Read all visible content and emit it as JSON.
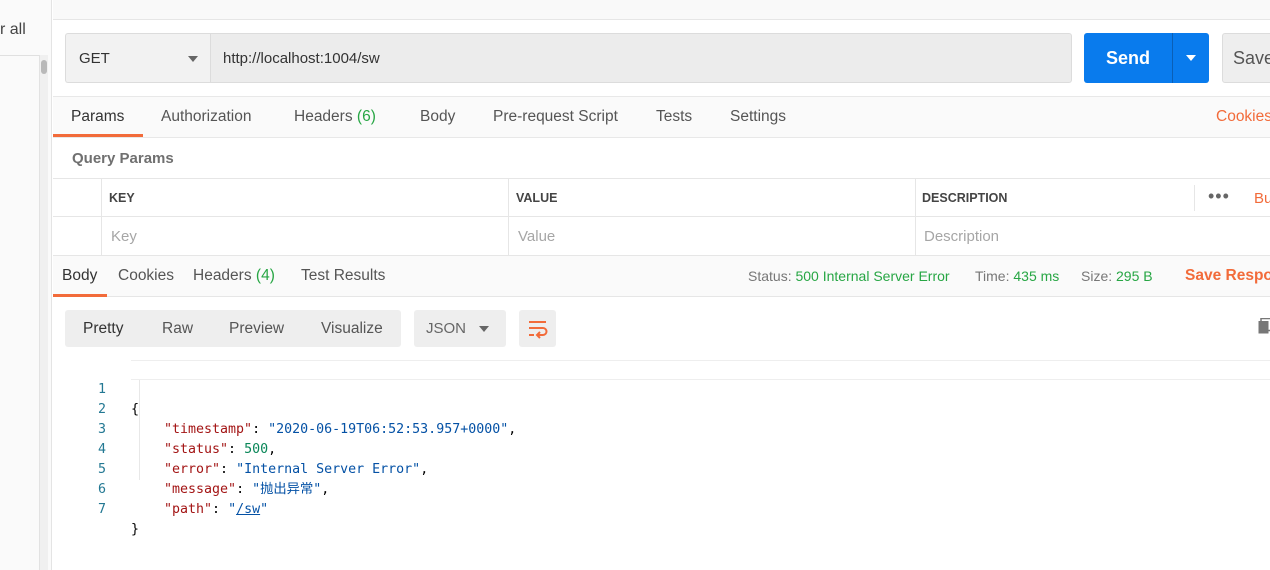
{
  "sidebar": {
    "partial_label": "r all"
  },
  "request": {
    "method": "GET",
    "url": "http://localhost:1004/sw",
    "send_label": "Send",
    "save_label": "Save"
  },
  "request_tabs": [
    {
      "label": "Params"
    },
    {
      "label": "Authorization"
    },
    {
      "label": "Headers",
      "count": "(6)"
    },
    {
      "label": "Body"
    },
    {
      "label": "Pre-request Script"
    },
    {
      "label": "Tests"
    },
    {
      "label": "Settings"
    }
  ],
  "cookies_label": "Cookies",
  "query_params": {
    "title": "Query Params",
    "columns": [
      "KEY",
      "VALUE",
      "DESCRIPTION"
    ],
    "placeholders": [
      "Key",
      "Value",
      "Description"
    ],
    "more_label": "•••",
    "bulk_label": "Bu"
  },
  "response": {
    "tabs": [
      {
        "label": "Body"
      },
      {
        "label": "Cookies"
      },
      {
        "label": "Headers",
        "count": "(4)"
      },
      {
        "label": "Test Results"
      }
    ],
    "status_label": "Status:",
    "status_value": "500 Internal Server Error",
    "time_label": "Time:",
    "time_value": "435 ms",
    "size_label": "Size:",
    "size_value": "295 B",
    "save_response_label": "Save Respor"
  },
  "view": {
    "tabs": [
      "Pretty",
      "Raw",
      "Preview",
      "Visualize"
    ],
    "format": "JSON"
  },
  "body": {
    "line_numbers": [
      "1",
      "2",
      "3",
      "4",
      "5",
      "6",
      "7"
    ],
    "open_brace": "{",
    "close_brace": "}",
    "timestamp_key": "\"timestamp\"",
    "timestamp_val": "\"2020-06-19T06:52:53.957+0000\"",
    "status_key": "\"status\"",
    "status_val": "500",
    "error_key": "\"error\"",
    "error_val": "\"Internal Server Error\"",
    "message_key": "\"message\"",
    "message_val": "\"抛出异常\"",
    "path_key": "\"path\"",
    "path_val_open": "\"",
    "path_val_link": "/sw",
    "path_val_close": "\""
  },
  "colors": {
    "accent_orange": "#f26b3a",
    "send_blue": "#097bed",
    "success_green": "#27a644"
  }
}
